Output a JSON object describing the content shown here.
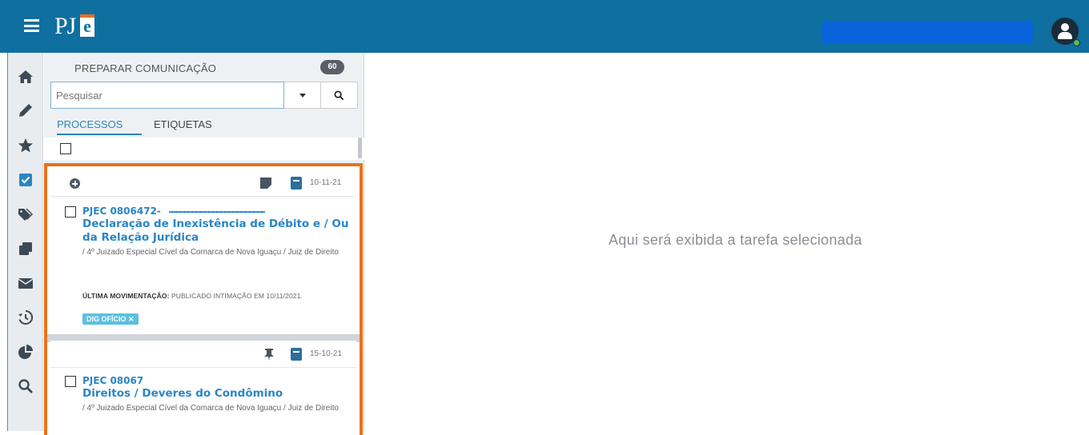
{
  "header": {
    "logo_text": "PJ",
    "logo_e": "e",
    "brand_color": "#0f6f9f",
    "accent_color": "#f26b21"
  },
  "sidebar": {
    "items": [
      {
        "icon": "home-icon"
      },
      {
        "icon": "pencil-icon"
      },
      {
        "icon": "star-icon"
      },
      {
        "icon": "checkbox-icon"
      },
      {
        "icon": "tags-icon"
      },
      {
        "icon": "clone-icon"
      },
      {
        "icon": "envelope-icon"
      },
      {
        "icon": "history-icon"
      },
      {
        "icon": "pie-chart-icon"
      },
      {
        "icon": "search-icon"
      }
    ]
  },
  "panel": {
    "title": "PREPARAR COMUNICAÇÃO",
    "count": "60",
    "search_placeholder": "Pesquisar",
    "tabs": [
      "PROCESSOS",
      "ETIQUETAS"
    ]
  },
  "cards": [
    {
      "date": "10-11-21",
      "number": "PJEC 0806472-",
      "class": "Declaração de Inexistência de Débito e / Ou da Relação Jurídica",
      "org": "/ 4º Juizado Especial Cível da Comarca de Nova Iguaçu / Juiz de Direito",
      "last_mov_label": "ÚLTIMA MOVIMENTAÇÃO:",
      "last_mov_text": "PUBLICADO INTIMAÇÃO EM 10/11/2021.",
      "tag": "DIG OFÍCIO ✕"
    },
    {
      "date": "15-10-21",
      "number": "PJEC 08067",
      "class": "Direitos / Deveres do Condômino",
      "org": "/ 4º Juizado Especial Cível da Comarca de Nova Iguaçu / Juiz de Direito"
    }
  ],
  "main": {
    "placeholder": "Aqui será exibida a tarefa selecionada"
  }
}
